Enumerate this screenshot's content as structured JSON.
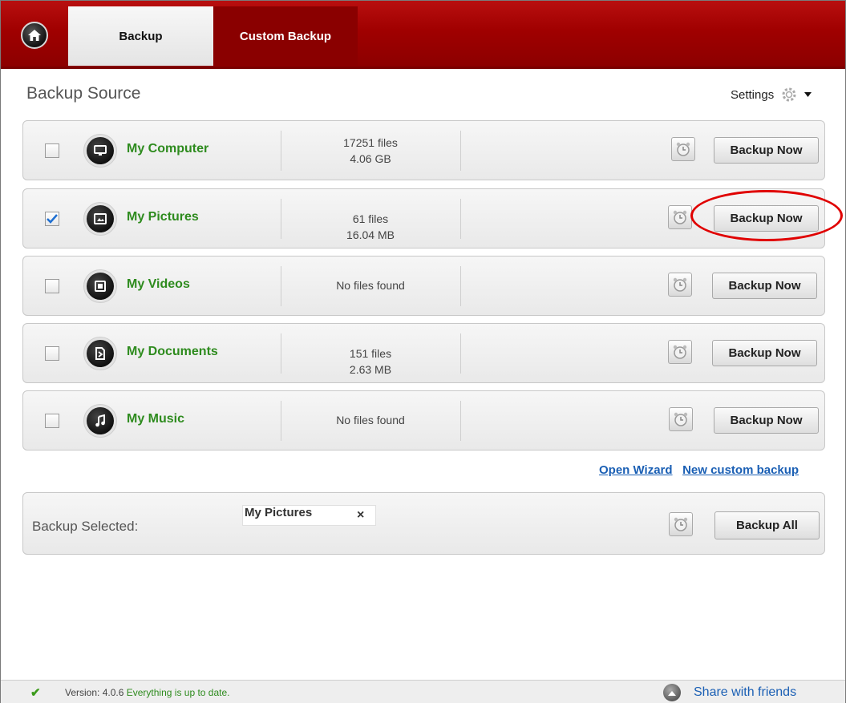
{
  "tabs": {
    "backup": "Backup",
    "custom_backup": "Custom Backup"
  },
  "section_title": "Backup Source",
  "settings_label": "Settings",
  "rows": [
    {
      "name": "My Computer",
      "line1": "17251 files",
      "line2": "4.06 GB",
      "checked": false,
      "icon": "monitor-icon"
    },
    {
      "name": "My Pictures",
      "line1": "61 files",
      "line2": "16.04 MB",
      "checked": true,
      "icon": "picture-icon"
    },
    {
      "name": "My Videos",
      "line1": "No files found",
      "line2": "",
      "checked": false,
      "icon": "film-icon"
    },
    {
      "name": "My Documents",
      "line1": "151 files",
      "line2": "2.63 MB",
      "checked": false,
      "icon": "document-icon"
    },
    {
      "name": "My Music",
      "line1": "No files found",
      "line2": "",
      "checked": false,
      "icon": "music-note-icon"
    }
  ],
  "backup_now_label": "Backup Now",
  "links": {
    "open_wizard": "Open Wizard",
    "new_custom_backup": "New custom backup"
  },
  "selected": {
    "label": "Backup Selected:",
    "chip": "My Pictures",
    "remove": "×",
    "backup_all": "Backup All"
  },
  "footer": {
    "version_label": "Version:",
    "version": "4.0.6",
    "status": "Everything is up to date.",
    "share": "Share with friends"
  },
  "colors": {
    "brand_red": "#a00000",
    "green_label": "#2e8b1e",
    "link_blue": "#1a5fb4",
    "annotation": "#e00000"
  }
}
